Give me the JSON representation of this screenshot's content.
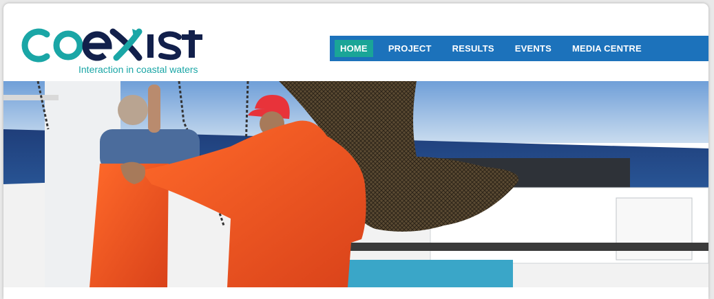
{
  "brand": {
    "logo_text": "COEXIST",
    "tagline": "Interaction in coastal waters",
    "colors": {
      "teal": "#1aa6a6",
      "navy": "#12204b"
    }
  },
  "nav": {
    "items": [
      {
        "label": "HOME",
        "active": true
      },
      {
        "label": "PROJECT",
        "active": false
      },
      {
        "label": "RESULTS",
        "active": false
      },
      {
        "label": "EVENTS",
        "active": false
      },
      {
        "label": "MEDIA CENTRE",
        "active": false
      }
    ],
    "colors": {
      "bar": "#1c72bb",
      "active": "#1aa597"
    }
  },
  "hero": {
    "icon": "fishermen-hauling-net-photo"
  }
}
